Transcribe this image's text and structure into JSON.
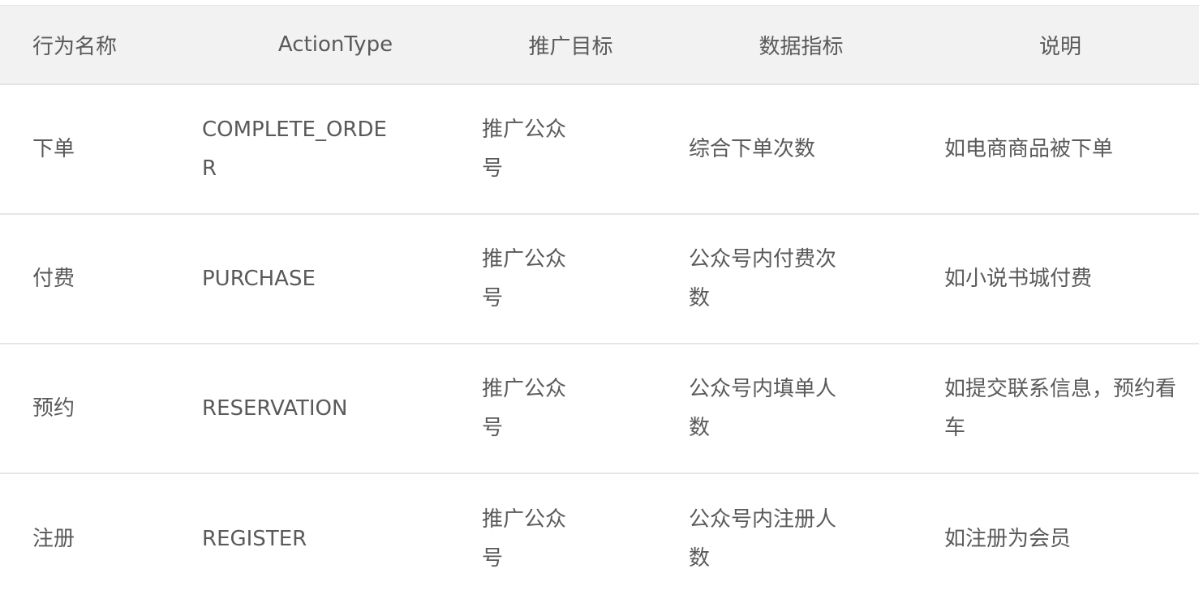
{
  "table": {
    "headers": [
      "行为名称",
      "ActionType",
      "推广目标",
      "数据指标",
      "说明"
    ],
    "rows": [
      {
        "name": "下单",
        "action_type": "COMPLETE_ORDER",
        "goal": "推广公众号",
        "metric": "综合下单次数",
        "description": "如电商商品被下单"
      },
      {
        "name": "付费",
        "action_type": "PURCHASE",
        "goal": "推广公众号",
        "metric": "公众号内付费次数",
        "description": "如小说书城付费"
      },
      {
        "name": "预约",
        "action_type": "RESERVATION",
        "goal": "推广公众号",
        "metric": "公众号内填单人数",
        "description": "如提交联系信息，预约看车"
      },
      {
        "name": "注册",
        "action_type": "REGISTER",
        "goal": "推广公众号",
        "metric": "公众号内注册人数",
        "description": "如注册为会员"
      }
    ]
  }
}
